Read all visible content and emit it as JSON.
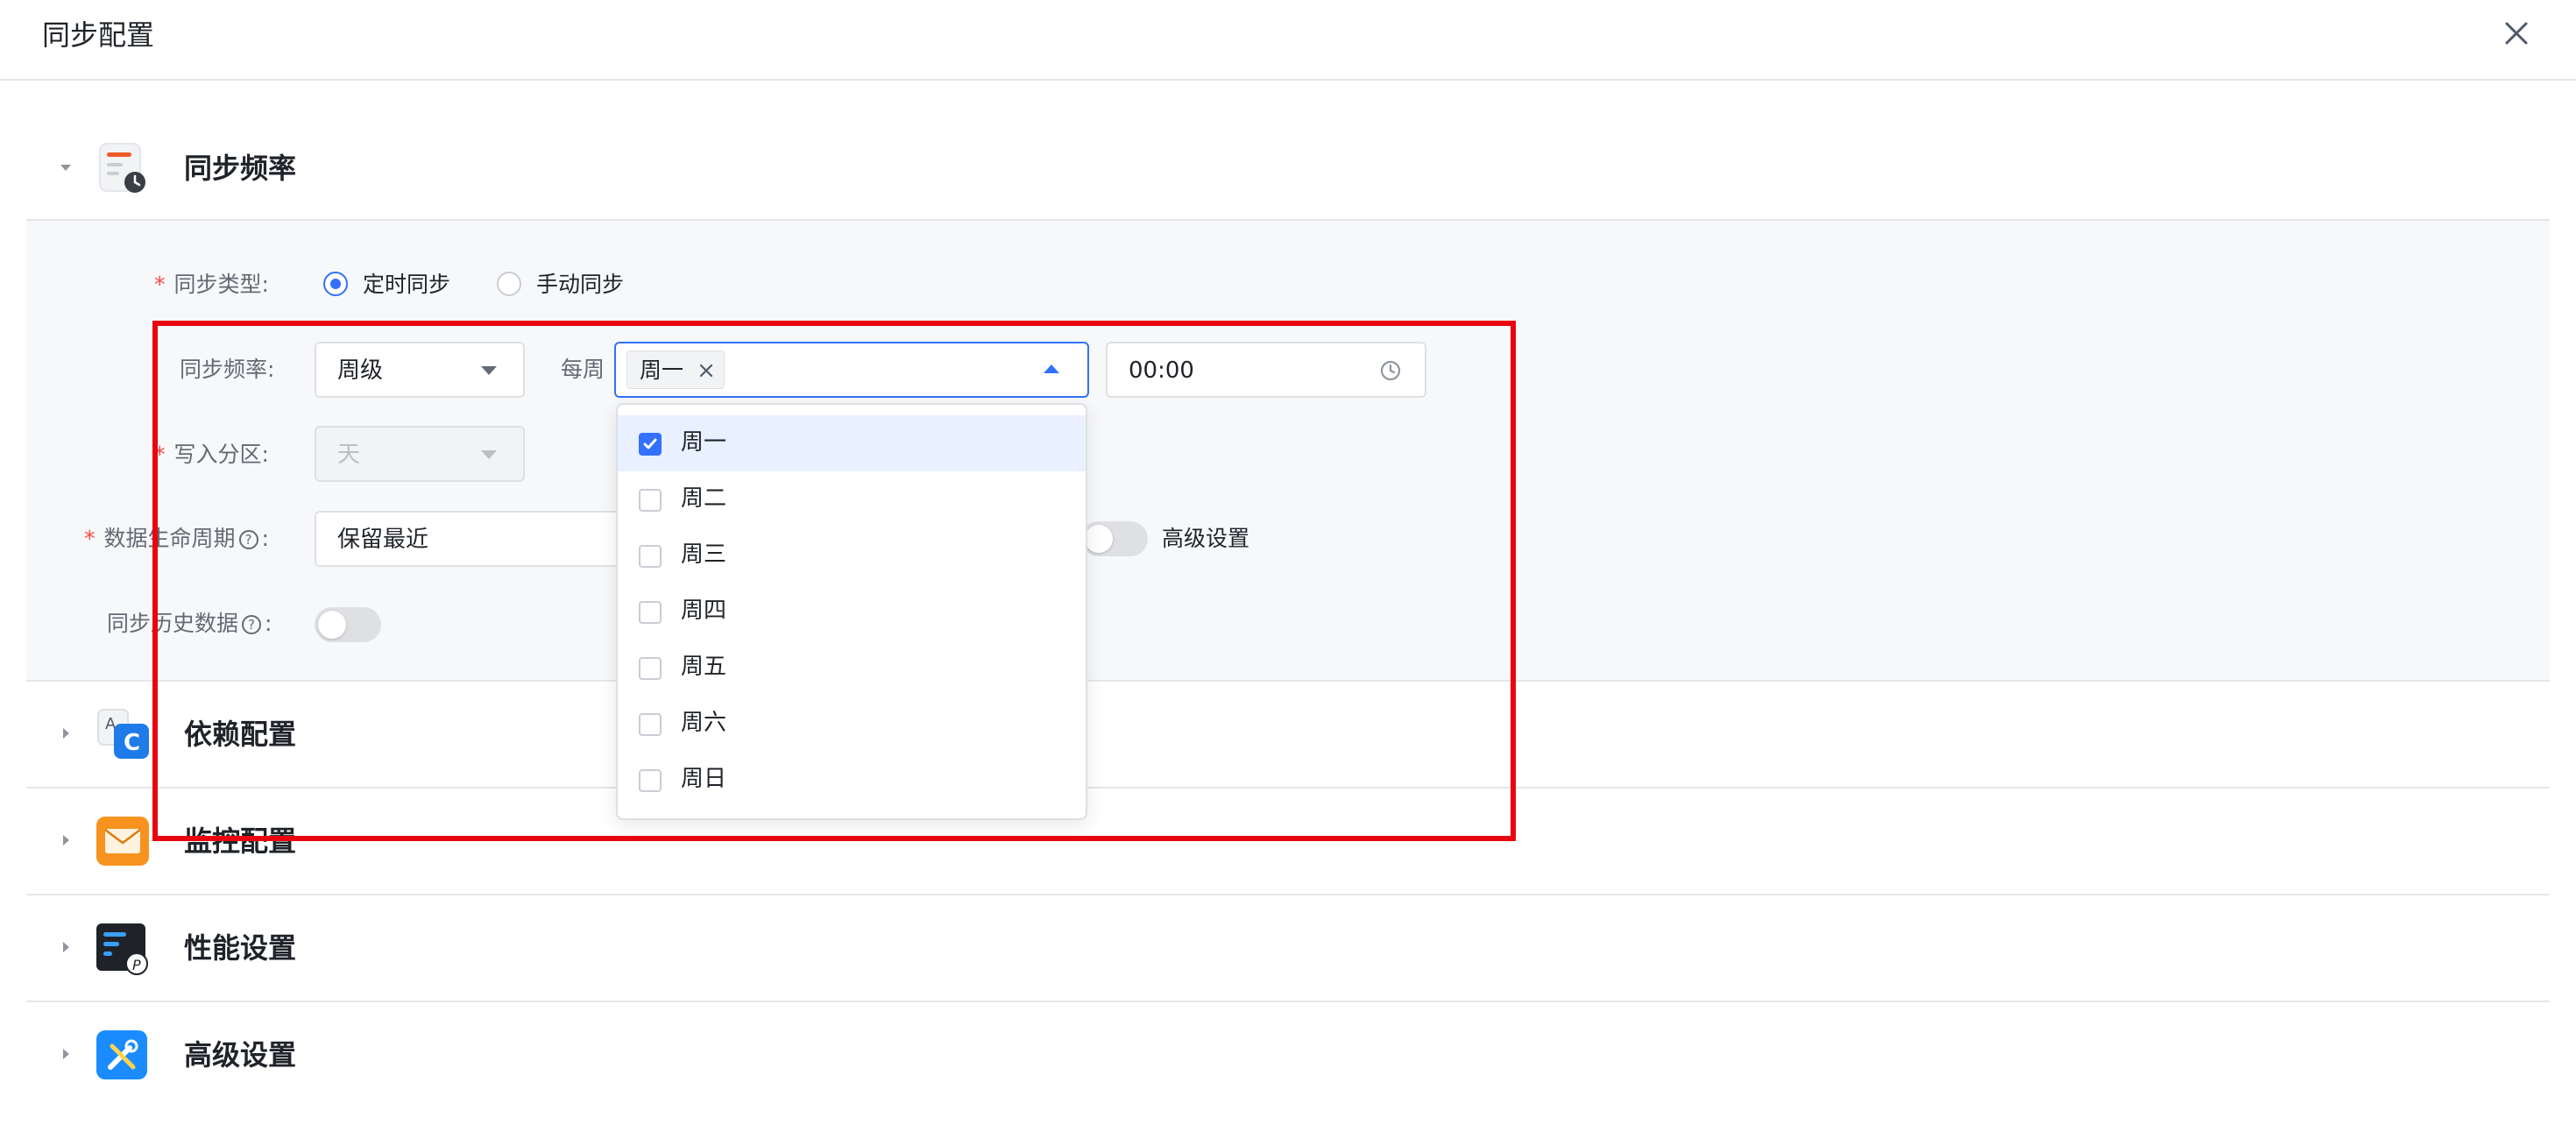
{
  "header": {
    "title": "同步配置"
  },
  "sections": [
    {
      "title": "同步频率",
      "icon": "schedule-doc-icon"
    },
    {
      "title": "依赖配置",
      "icon": "dependency-icon"
    },
    {
      "title": "监控配置",
      "icon": "mail-icon"
    },
    {
      "title": "性能设置",
      "icon": "performance-icon"
    },
    {
      "title": "高级设置",
      "icon": "tools-icon"
    }
  ],
  "form": {
    "sync_type": {
      "label": "同步类型:",
      "options": [
        "定时同步",
        "手动同步"
      ],
      "selected": "定时同步"
    },
    "frequency": {
      "label": "同步频率:",
      "value": "周级",
      "per_week_label": "每周",
      "selected_tag": "周一",
      "time_value": "00:00"
    },
    "partition": {
      "label": "写入分区:",
      "value": "天"
    },
    "lifecycle": {
      "label": "数据生命周期",
      "colon": ":",
      "value": "保留最近",
      "advanced_label": "高级设置"
    },
    "history": {
      "label": "同步历史数据",
      "colon": ":"
    }
  },
  "dropdown": {
    "options": [
      {
        "label": "周一",
        "checked": true
      },
      {
        "label": "周二",
        "checked": false
      },
      {
        "label": "周三",
        "checked": false
      },
      {
        "label": "周四",
        "checked": false
      },
      {
        "label": "周五",
        "checked": false
      },
      {
        "label": "周六",
        "checked": false
      },
      {
        "label": "周日",
        "checked": false
      }
    ]
  },
  "colors": {
    "accent": "#3370ff",
    "required": "#f54a45",
    "highlight": "#e8050f"
  }
}
